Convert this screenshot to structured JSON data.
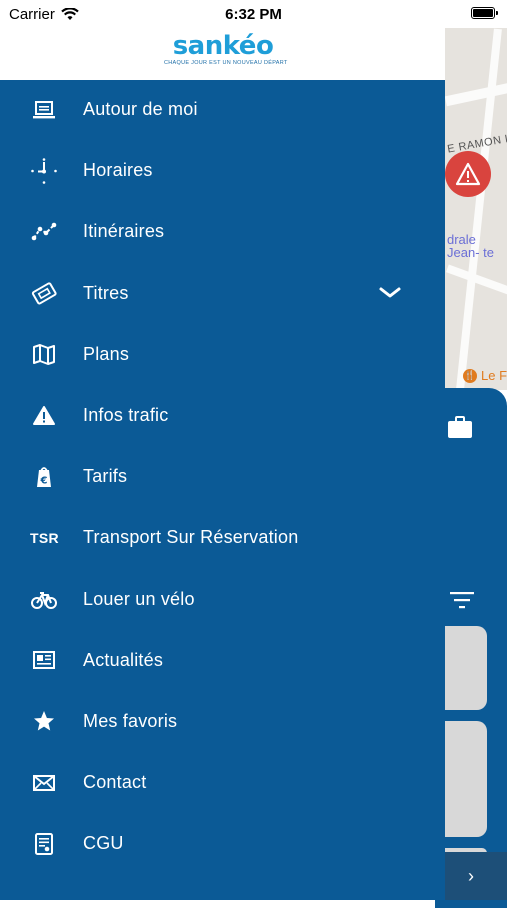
{
  "status_bar": {
    "carrier": "Carrier",
    "time": "6:32 PM"
  },
  "app": {
    "logo_text": "sankéo",
    "tagline": "CHAQUE JOUR EST UN NOUVEAU DÉPART"
  },
  "menu": {
    "items": [
      {
        "label": "Autour de moi",
        "icon": "laptop-icon"
      },
      {
        "label": "Horaires",
        "icon": "clock-icon"
      },
      {
        "label": "Itinéraires",
        "icon": "route-icon"
      },
      {
        "label": "Titres",
        "icon": "ticket-icon"
      },
      {
        "label": "Plans",
        "icon": "map-icon"
      },
      {
        "label": "Infos trafic",
        "icon": "warning-icon"
      },
      {
        "label": "Tarifs",
        "icon": "price-tag-icon"
      },
      {
        "label": "Transport Sur Réservation",
        "icon": "tsr-icon",
        "icon_text": "TSR"
      },
      {
        "label": "Louer un vélo",
        "icon": "bicycle-icon"
      },
      {
        "label": "Actualités",
        "icon": "newspaper-icon"
      },
      {
        "label": "Mes favoris",
        "icon": "star-icon"
      },
      {
        "label": "Contact",
        "icon": "envelope-icon"
      },
      {
        "label": "CGU",
        "icon": "document-icon"
      }
    ]
  },
  "background": {
    "street_label": "E RAMON L",
    "poi_label": "drale Jean- te",
    "restaurant_label": "Le F"
  },
  "colors": {
    "drawer": "#0b5a96",
    "accent": "#1f9ed8",
    "warning_marker": "#d9443e"
  }
}
